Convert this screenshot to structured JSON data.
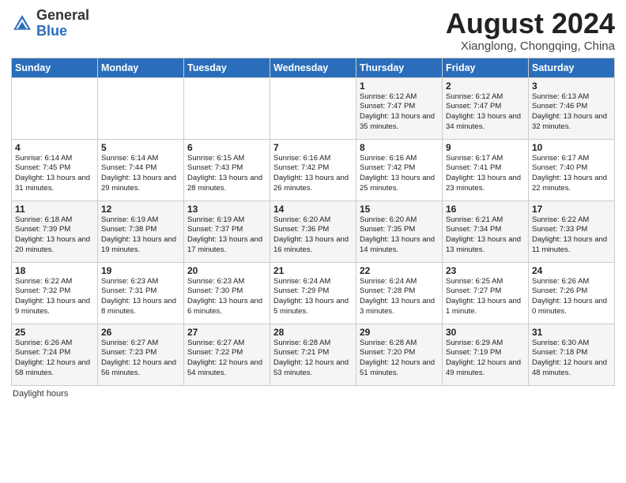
{
  "header": {
    "logo_general": "General",
    "logo_blue": "Blue",
    "month_year": "August 2024",
    "location": "Xianglong, Chongqing, China"
  },
  "days_of_week": [
    "Sunday",
    "Monday",
    "Tuesday",
    "Wednesday",
    "Thursday",
    "Friday",
    "Saturday"
  ],
  "weeks": [
    [
      {
        "day": "",
        "info": ""
      },
      {
        "day": "",
        "info": ""
      },
      {
        "day": "",
        "info": ""
      },
      {
        "day": "",
        "info": ""
      },
      {
        "day": "1",
        "info": "Sunrise: 6:12 AM\nSunset: 7:47 PM\nDaylight: 13 hours and 35 minutes."
      },
      {
        "day": "2",
        "info": "Sunrise: 6:12 AM\nSunset: 7:47 PM\nDaylight: 13 hours and 34 minutes."
      },
      {
        "day": "3",
        "info": "Sunrise: 6:13 AM\nSunset: 7:46 PM\nDaylight: 13 hours and 32 minutes."
      }
    ],
    [
      {
        "day": "4",
        "info": "Sunrise: 6:14 AM\nSunset: 7:45 PM\nDaylight: 13 hours and 31 minutes."
      },
      {
        "day": "5",
        "info": "Sunrise: 6:14 AM\nSunset: 7:44 PM\nDaylight: 13 hours and 29 minutes."
      },
      {
        "day": "6",
        "info": "Sunrise: 6:15 AM\nSunset: 7:43 PM\nDaylight: 13 hours and 28 minutes."
      },
      {
        "day": "7",
        "info": "Sunrise: 6:16 AM\nSunset: 7:42 PM\nDaylight: 13 hours and 26 minutes."
      },
      {
        "day": "8",
        "info": "Sunrise: 6:16 AM\nSunset: 7:42 PM\nDaylight: 13 hours and 25 minutes."
      },
      {
        "day": "9",
        "info": "Sunrise: 6:17 AM\nSunset: 7:41 PM\nDaylight: 13 hours and 23 minutes."
      },
      {
        "day": "10",
        "info": "Sunrise: 6:17 AM\nSunset: 7:40 PM\nDaylight: 13 hours and 22 minutes."
      }
    ],
    [
      {
        "day": "11",
        "info": "Sunrise: 6:18 AM\nSunset: 7:39 PM\nDaylight: 13 hours and 20 minutes."
      },
      {
        "day": "12",
        "info": "Sunrise: 6:19 AM\nSunset: 7:38 PM\nDaylight: 13 hours and 19 minutes."
      },
      {
        "day": "13",
        "info": "Sunrise: 6:19 AM\nSunset: 7:37 PM\nDaylight: 13 hours and 17 minutes."
      },
      {
        "day": "14",
        "info": "Sunrise: 6:20 AM\nSunset: 7:36 PM\nDaylight: 13 hours and 16 minutes."
      },
      {
        "day": "15",
        "info": "Sunrise: 6:20 AM\nSunset: 7:35 PM\nDaylight: 13 hours and 14 minutes."
      },
      {
        "day": "16",
        "info": "Sunrise: 6:21 AM\nSunset: 7:34 PM\nDaylight: 13 hours and 13 minutes."
      },
      {
        "day": "17",
        "info": "Sunrise: 6:22 AM\nSunset: 7:33 PM\nDaylight: 13 hours and 11 minutes."
      }
    ],
    [
      {
        "day": "18",
        "info": "Sunrise: 6:22 AM\nSunset: 7:32 PM\nDaylight: 13 hours and 9 minutes."
      },
      {
        "day": "19",
        "info": "Sunrise: 6:23 AM\nSunset: 7:31 PM\nDaylight: 13 hours and 8 minutes."
      },
      {
        "day": "20",
        "info": "Sunrise: 6:23 AM\nSunset: 7:30 PM\nDaylight: 13 hours and 6 minutes."
      },
      {
        "day": "21",
        "info": "Sunrise: 6:24 AM\nSunset: 7:29 PM\nDaylight: 13 hours and 5 minutes."
      },
      {
        "day": "22",
        "info": "Sunrise: 6:24 AM\nSunset: 7:28 PM\nDaylight: 13 hours and 3 minutes."
      },
      {
        "day": "23",
        "info": "Sunrise: 6:25 AM\nSunset: 7:27 PM\nDaylight: 13 hours and 1 minute."
      },
      {
        "day": "24",
        "info": "Sunrise: 6:26 AM\nSunset: 7:26 PM\nDaylight: 13 hours and 0 minutes."
      }
    ],
    [
      {
        "day": "25",
        "info": "Sunrise: 6:26 AM\nSunset: 7:24 PM\nDaylight: 12 hours and 58 minutes."
      },
      {
        "day": "26",
        "info": "Sunrise: 6:27 AM\nSunset: 7:23 PM\nDaylight: 12 hours and 56 minutes."
      },
      {
        "day": "27",
        "info": "Sunrise: 6:27 AM\nSunset: 7:22 PM\nDaylight: 12 hours and 54 minutes."
      },
      {
        "day": "28",
        "info": "Sunrise: 6:28 AM\nSunset: 7:21 PM\nDaylight: 12 hours and 53 minutes."
      },
      {
        "day": "29",
        "info": "Sunrise: 6:28 AM\nSunset: 7:20 PM\nDaylight: 12 hours and 51 minutes."
      },
      {
        "day": "30",
        "info": "Sunrise: 6:29 AM\nSunset: 7:19 PM\nDaylight: 12 hours and 49 minutes."
      },
      {
        "day": "31",
        "info": "Sunrise: 6:30 AM\nSunset: 7:18 PM\nDaylight: 12 hours and 48 minutes."
      }
    ]
  ],
  "footer": {
    "daylight_hours": "Daylight hours"
  }
}
